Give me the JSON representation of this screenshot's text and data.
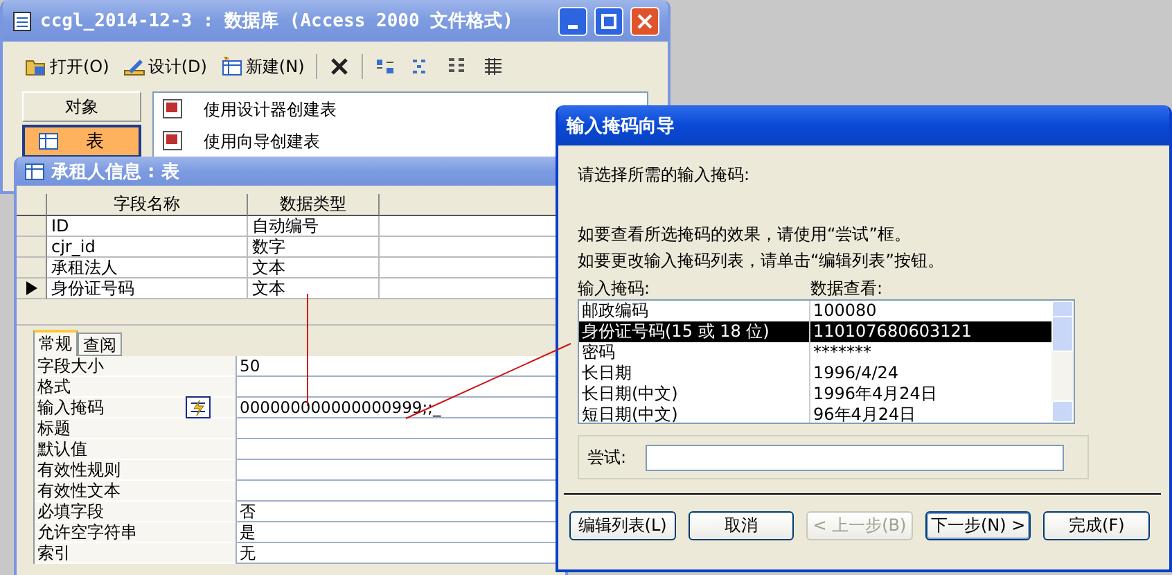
{
  "database_window": {
    "title": "ccgl_2014-12-3 : 数据库 (Access 2000 文件格式)",
    "toolbar": [
      {
        "kind": "open",
        "label": "打开(O)"
      },
      {
        "kind": "design",
        "label": "设计(D)"
      },
      {
        "kind": "new",
        "label": "新建(N)"
      },
      {
        "kind": "delete"
      },
      {
        "kind": "large"
      },
      {
        "kind": "small"
      },
      {
        "kind": "list"
      },
      {
        "kind": "details"
      }
    ],
    "objects_header": "对象",
    "objects": [
      {
        "label": "表",
        "selected": true
      }
    ],
    "items": [
      "使用设计器创建表",
      "使用向导创建表"
    ]
  },
  "table_window": {
    "title": "承租人信息 : 表",
    "columns": [
      "字段名称",
      "数据类型"
    ],
    "rows": [
      {
        "name": "ID",
        "type": "自动编号",
        "current": false
      },
      {
        "name": "cjr_id",
        "type": "数字",
        "current": false
      },
      {
        "name": "承租法人",
        "type": "文本",
        "current": false
      },
      {
        "name": "身份证号码",
        "type": "文本",
        "current": true
      }
    ],
    "tabs": [
      {
        "label": "常规",
        "selected": true
      },
      {
        "label": "查阅",
        "selected": false
      }
    ],
    "properties": [
      {
        "label": "字段大小",
        "value": "50"
      },
      {
        "label": "格式"
      },
      {
        "label": "输入掩码",
        "value": "000000000000000999;;_",
        "builder": true
      },
      {
        "label": "标题"
      },
      {
        "label": "默认值"
      },
      {
        "label": "有效性规则"
      },
      {
        "label": "有效性文本"
      },
      {
        "label": "必填字段",
        "value": "否"
      },
      {
        "label": "允许空字符串",
        "value": "是"
      },
      {
        "label": "索引",
        "value": "无"
      }
    ]
  },
  "wizard": {
    "title": "输入掩码向导",
    "prompt": "请选择所需的输入掩码:",
    "hints": [
      "如要查看所选掩码的效果，请使用“尝试”框。",
      "如要更改输入掩码列表，请单击“编辑列表”按钮。"
    ],
    "list_columns": [
      "输入掩码:",
      "数据查看:"
    ],
    "masks": [
      {
        "name": "邮政编码",
        "preview": "100080",
        "selected": false
      },
      {
        "name": "身份证号码(15 或 18 位)",
        "preview": "110107680603121",
        "selected": true
      },
      {
        "name": "密码",
        "preview": "*******",
        "selected": false
      },
      {
        "name": "长日期",
        "preview": "1996/4/24",
        "selected": false
      },
      {
        "name": "长日期(中文)",
        "preview": "1996年4月24日",
        "selected": false
      },
      {
        "name": "短日期(中文)",
        "preview": "96年4月24日",
        "selected": false
      }
    ],
    "try_label": "尝试:",
    "buttons": [
      {
        "label": "编辑列表(L)",
        "disabled": false,
        "default": false
      },
      {
        "label": "取消",
        "disabled": false,
        "default": false
      },
      {
        "label": "< 上一步(B)",
        "disabled": true,
        "default": false
      },
      {
        "label": "下一步(N) >",
        "disabled": false,
        "default": true
      },
      {
        "label": "完成(F)",
        "disabled": false,
        "default": false
      }
    ]
  }
}
